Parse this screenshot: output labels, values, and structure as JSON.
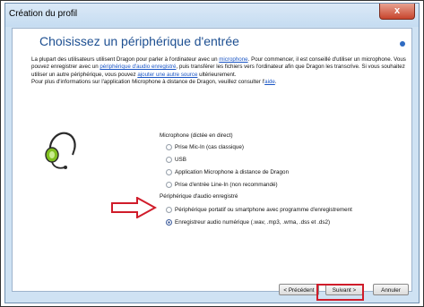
{
  "window": {
    "title": "Création du profil",
    "close_label": "x"
  },
  "page": {
    "heading": "Choisissez un périphérique d'entrée",
    "intro": {
      "p1_a": "La plupart des utilisateurs utilisent Dragon pour parler à l'ordinateur avec un ",
      "link_microphone": "microphone",
      "p1_b": ". Pour commencer, il est conseillé d'utiliser un microphone. Vous pouvez enregistrer avec un ",
      "link_recorder": "périphérique d'audio enregistré",
      "p1_c": ", puis transférer les fichiers vers l'ordinateur afin que Dragon les transcrive. Si vous souhaitez utiliser un autre périphérique, vous pouvez ",
      "link_source": "ajouter une autre source",
      "p1_d": " ultérieurement.",
      "p2_a": "Pour plus d'informations sur l'application Microphone à distance de Dragon, veuillez consulter l'",
      "link_help": "aide",
      "p2_b": "."
    }
  },
  "groups": {
    "microphone_label": "Microphone (dictée en direct)",
    "microphone_options": [
      "Prise Mic-In (cas classique)",
      "USB",
      "Application Microphone à distance de Dragon",
      "Prise d'entrée Line-In (non recommandé)"
    ],
    "recorded_label": "Périphérique d'audio enregistré",
    "recorded_options": [
      "Périphérique portatif ou smartphone avec programme d'enregistrement",
      "Enregistreur audio numérique (.wav, .mp3, .wma, .dss et .ds2)"
    ],
    "selected": "Enregistreur audio numérique (.wav, .mp3, .wma, .dss et .ds2)"
  },
  "buttons": {
    "previous": "< Précédent",
    "next": "Suivant >",
    "cancel": "Annuler"
  },
  "colors": {
    "heading": "#1d4f91",
    "highlight": "#d01c2a",
    "headset_green": "#7fbf1f"
  },
  "icons": {
    "headset": "headset-icon",
    "arrow": "red-arrow-icon",
    "help": "help-icon"
  }
}
